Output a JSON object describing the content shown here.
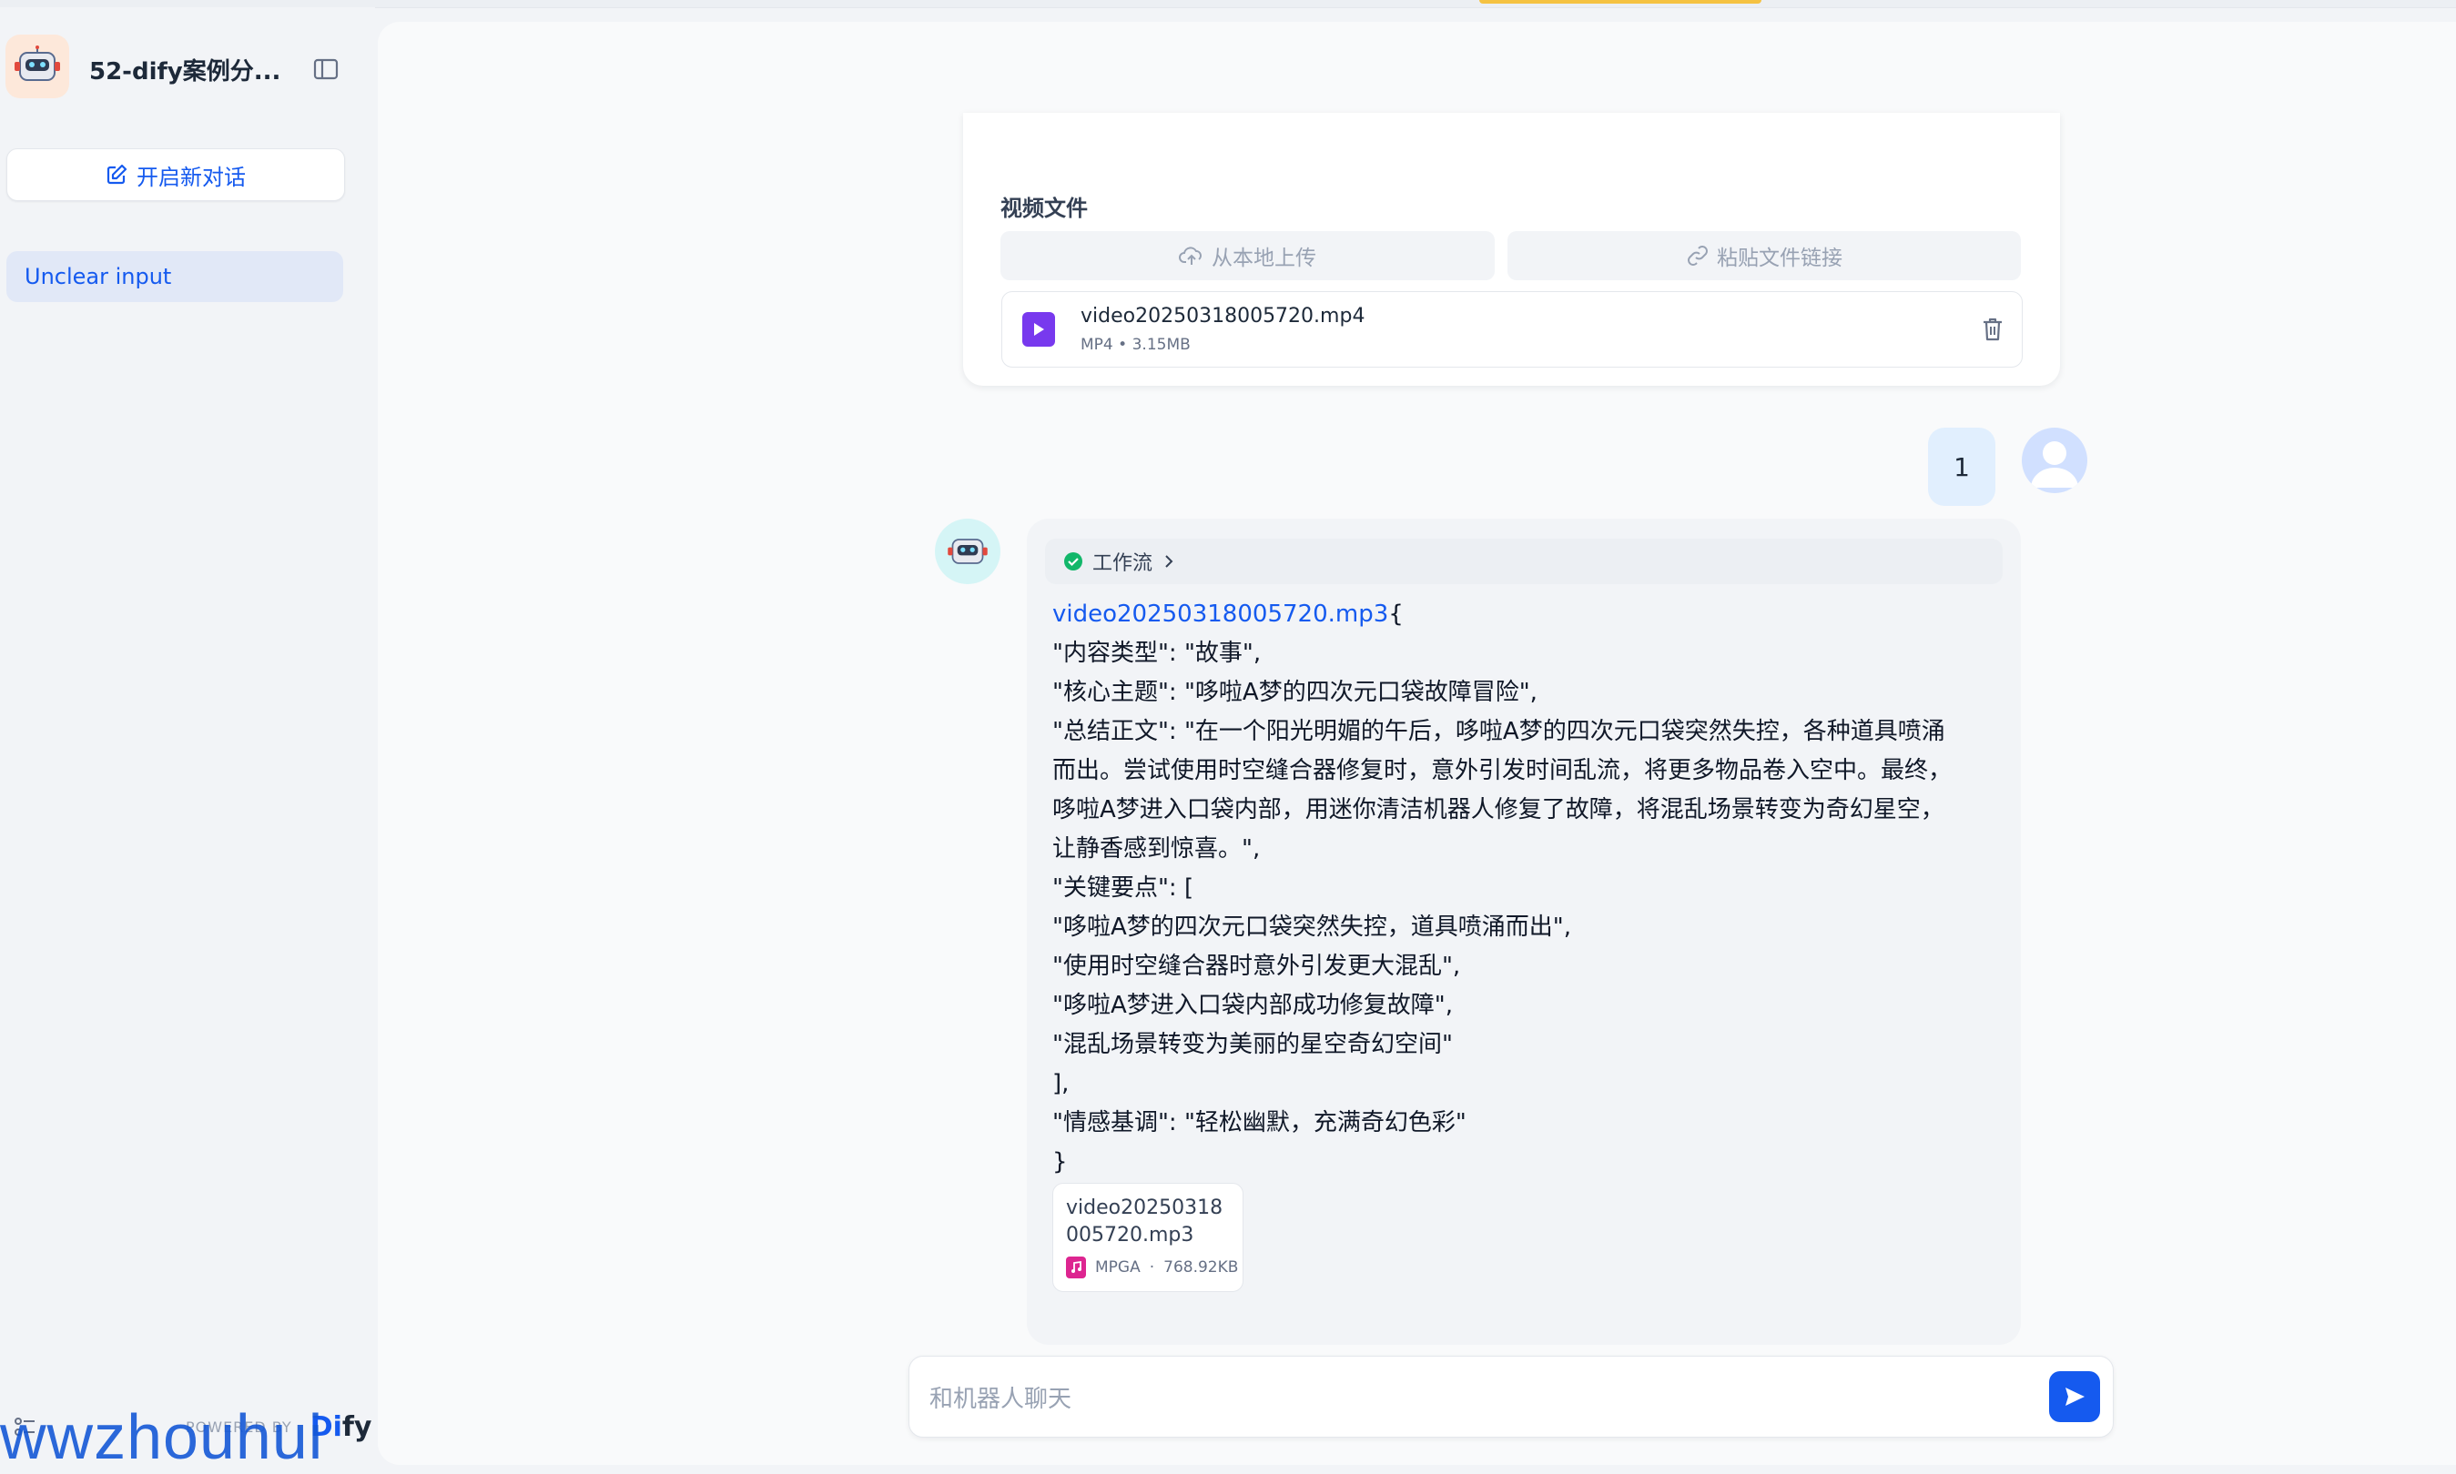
{
  "app": {
    "title": "52-dify案例分...",
    "new_chat_label": "开启新对话",
    "conversations": [
      {
        "label": "Unclear input",
        "active": true
      }
    ]
  },
  "footer": {
    "powered_by": "POWERED BY",
    "brand_left": "Di",
    "brand_right": "fy",
    "watermark": "wwzhouhui"
  },
  "form": {
    "label": "视频文件",
    "upload_local": "从本地上传",
    "paste_link": "粘贴文件链接",
    "file": {
      "name": "video20250318005720.mp4",
      "type": "MP4",
      "size": "3.15MB"
    }
  },
  "user_message": {
    "text": "1"
  },
  "bot_message": {
    "workflow_label": "工作流",
    "link_text": "video20250318005720.mp3",
    "lines": [
      "{",
      "\"内容类型\": \"故事\",",
      "\"核心主题\": \"哆啦A梦的四次元口袋故障冒险\",",
      "\"总结正文\": \"在一个阳光明媚的午后，哆啦A梦的四次元口袋突然失控，各种道具喷涌",
      "而出。尝试使用时空缝合器修复时，意外引发时间乱流，将更多物品卷入空中。最终，",
      "哆啦A梦进入口袋内部，用迷你清洁机器人修复了故障，将混乱场景转变为奇幻星空，",
      "让静香感到惊喜。\",",
      "\"关键要点\": [",
      "\"哆啦A梦的四次元口袋突然失控，道具喷涌而出\",",
      "\"使用时空缝合器时意外引发更大混乱\",",
      "\"哆啦A梦进入口袋内部成功修复故障\",",
      "\"混乱场景转变为美丽的星空奇幻空间\"",
      "],",
      "\"情感基调\": \"轻松幽默，充满奇幻色彩\"",
      "}"
    ],
    "attachment": {
      "name": "video20250318005720.mp3",
      "type": "MPGA",
      "size": "768.92KB"
    }
  },
  "input": {
    "placeholder": "和机器人聊天"
  },
  "colors": {
    "accent": "#155aef",
    "video_icon": "#7839ee",
    "audio_icon": "#dd2590",
    "success": "#12b76a"
  }
}
